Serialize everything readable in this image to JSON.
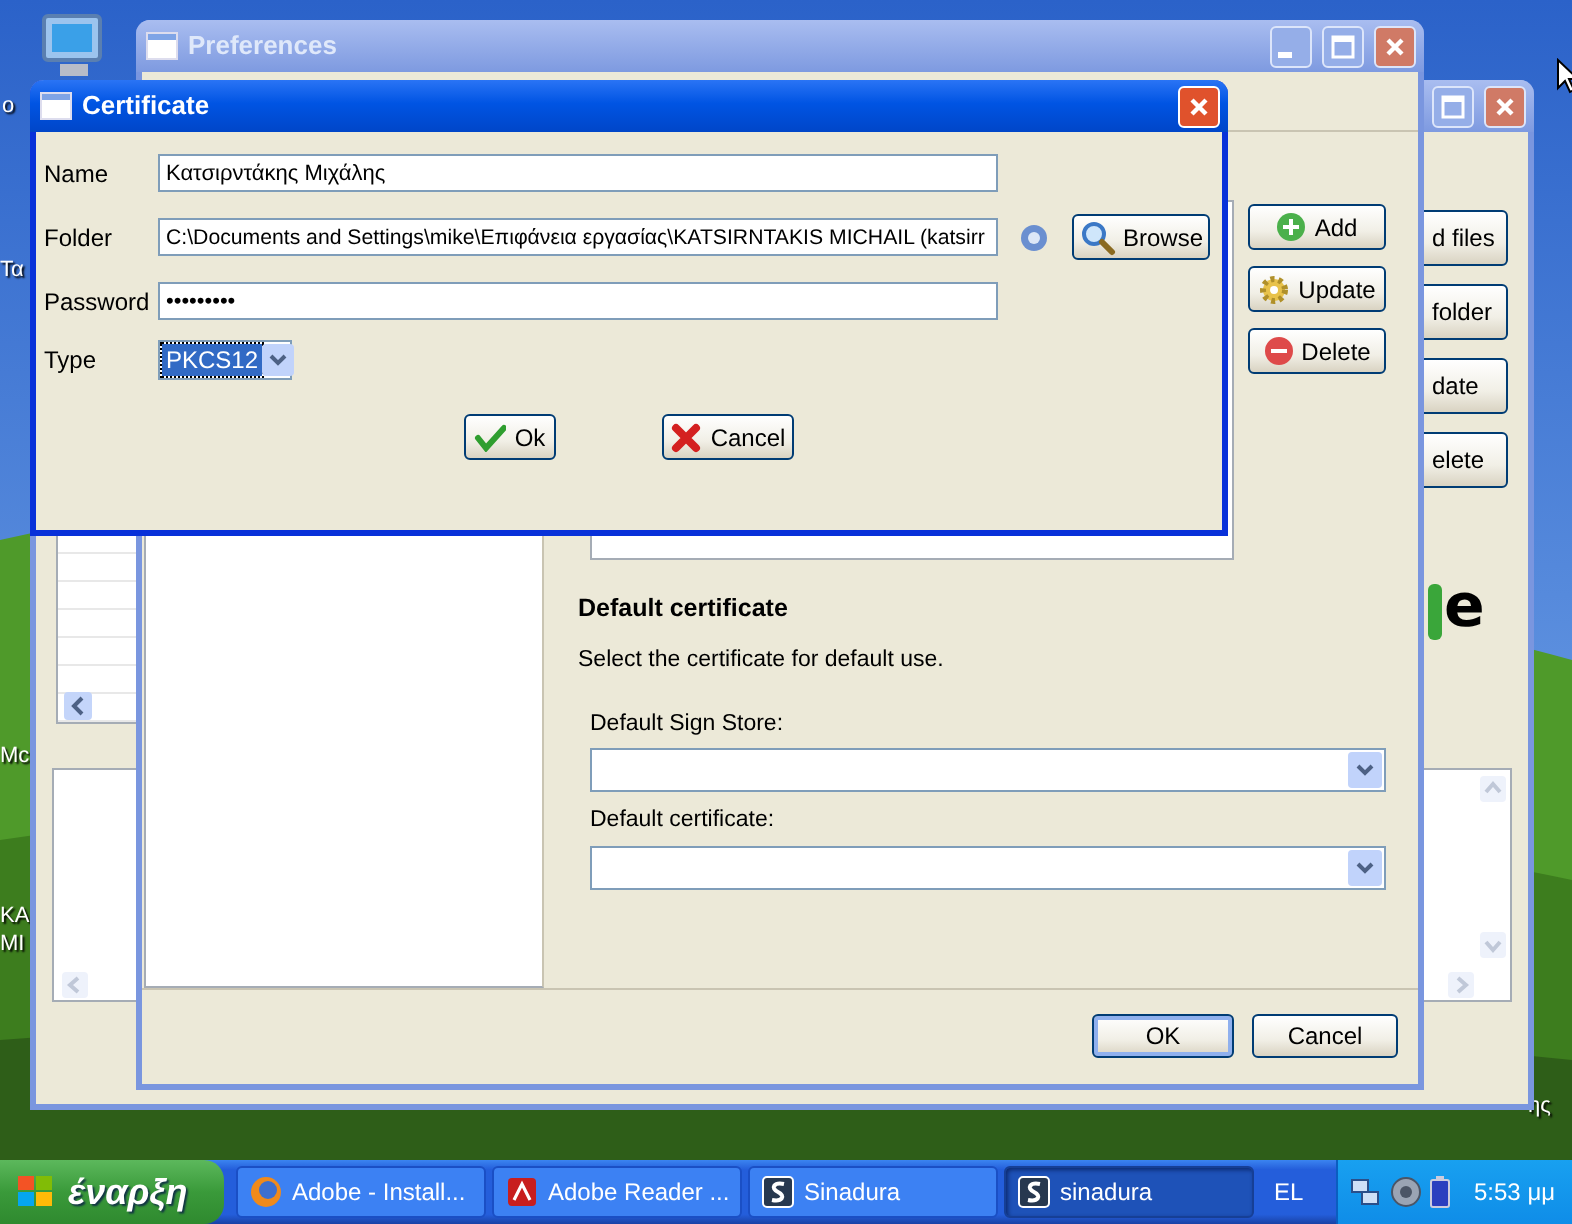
{
  "desktop": {
    "labels": [
      "o",
      "Τα",
      "Mc",
      "KA",
      "MI",
      "ης"
    ]
  },
  "background_window": {
    "buttons": [
      "d files",
      "folder",
      "date",
      "elete"
    ],
    "logo_text": "e"
  },
  "preferences": {
    "title": "Preferences",
    "active": false,
    "certificate_buttons": [
      {
        "kind": "add",
        "label": "Add"
      },
      {
        "kind": "update",
        "label": "Update"
      },
      {
        "kind": "delete",
        "label": "Delete"
      }
    ],
    "section_title": "Default certificate",
    "section_hint": "Select the certificate for default use.",
    "selects": [
      {
        "label": "Default Sign Store:"
      },
      {
        "label": "Default certificate:"
      }
    ],
    "buttons": [
      {
        "label": "OK",
        "default": true
      },
      {
        "label": "Cancel",
        "default": false
      }
    ]
  },
  "certificate": {
    "title": "Certificate",
    "active": true,
    "fields": [
      {
        "kind": "text",
        "label": "Name",
        "value": "Κατσιρντάκης Μιχάλης"
      },
      {
        "kind": "folder",
        "label": "Folder",
        "value": "C:\\Documents and Settings\\mike\\Επιφάνεια εργασίας\\KATSIRNTAKIS MICHAIL (katsirr",
        "button": "Browse"
      },
      {
        "kind": "text",
        "label": "Password",
        "value": "•••••••••"
      },
      {
        "kind": "select",
        "label": "Type",
        "value": "PKCS12",
        "focused": true
      }
    ],
    "buttons": [
      {
        "kind": "ok",
        "label": "Ok"
      },
      {
        "kind": "cancel",
        "label": "Cancel"
      }
    ]
  },
  "taskbar": {
    "start": "έναρξη",
    "tasks": [
      {
        "kind": "firefox",
        "label": "Adobe - Install...",
        "selected": false
      },
      {
        "kind": "adobe",
        "label": "Adobe Reader ...",
        "selected": false
      },
      {
        "kind": "sinadura",
        "label": "Sinadura",
        "selected": false
      },
      {
        "kind": "sinadura",
        "label": "sinadura",
        "selected": true
      }
    ],
    "language": "EL",
    "clock": "5:53 μμ"
  }
}
